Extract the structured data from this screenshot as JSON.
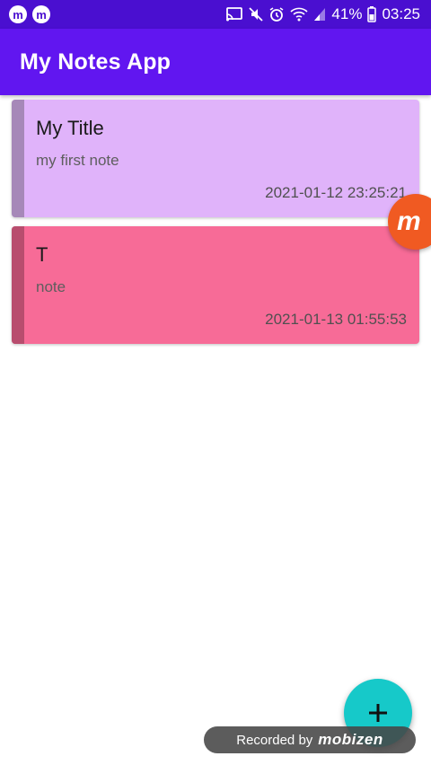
{
  "status_bar": {
    "battery": "41%",
    "time": "03:25",
    "left_icons": [
      "mobizen-icon",
      "mobizen-icon"
    ],
    "right_icons": [
      "cast-icon",
      "mute-icon",
      "alarm-icon",
      "wifi-icon",
      "signal-icon",
      "battery-icon"
    ]
  },
  "app_bar": {
    "title": "My Notes App"
  },
  "notes": [
    {
      "title": "My Title",
      "body": "my first note",
      "date": "2021-01-12 23:25:21",
      "color": "#e0b3fa",
      "stripe_color": "#a688b8"
    },
    {
      "title": "T",
      "body": "note",
      "date": "2021-01-13 01:55:53",
      "color": "#f76b97",
      "stripe_color": "#b84d6e"
    }
  ],
  "overlay": {
    "bubble_letter": "m",
    "record_prefix": "Recorded by",
    "record_brand": "mobizen"
  },
  "fab": {
    "icon": "plus-icon"
  },
  "colors": {
    "status_bar": "#4a0fd0",
    "app_bar": "#6116f0",
    "fab": "#16c9c9",
    "bubble": "#f05a22"
  }
}
